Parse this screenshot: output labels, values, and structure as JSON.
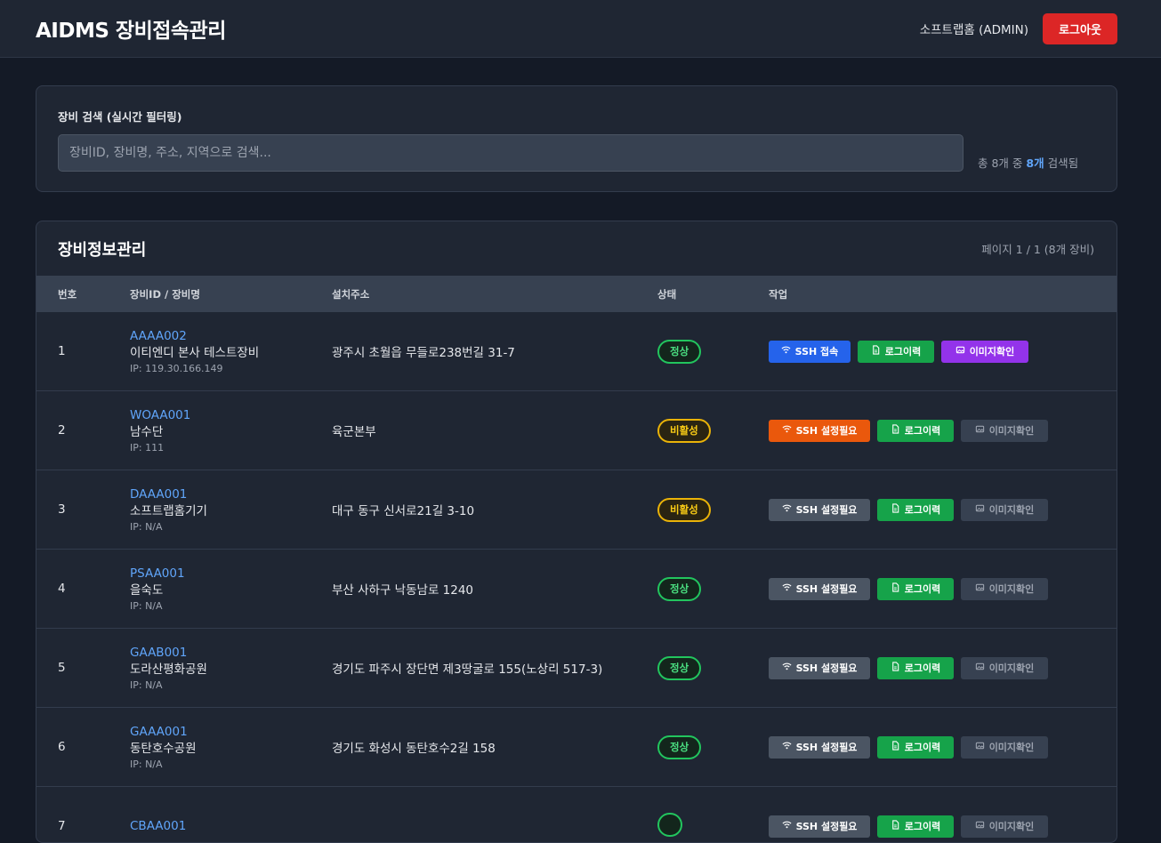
{
  "header": {
    "title": "AIDMS 장비접속관리",
    "user": "소프트랩홈 (ADMIN)",
    "logout_label": "로그아웃"
  },
  "search": {
    "label": "장비 검색 (실시간 필터링)",
    "placeholder": "장비ID, 장비명, 주소, 지역으로 검색...",
    "count_prefix": "총 8개 중",
    "count_value": "8개",
    "count_suffix": "검색됨"
  },
  "table": {
    "title": "장비정보관리",
    "page_info": "페이지 1 / 1 (8개 장비)",
    "columns": [
      "번호",
      "장비ID / 장비명",
      "설치주소",
      "상태",
      "작업"
    ],
    "rows": [
      {
        "no": "1",
        "id": "AAAA002",
        "name": "이티엔디 본사 테스트장비",
        "ip": "IP: 119.30.166.149",
        "address": "광주시 초월읍 무들로238번길 31-7",
        "status": "정상",
        "status_type": "ok",
        "ssh_label": "SSH 접속",
        "ssh_type": "blue",
        "log_label": "로그이력",
        "img_label": "이미지확인",
        "img_enabled": true
      },
      {
        "no": "2",
        "id": "WOAA001",
        "name": "남수단",
        "ip": "IP: 111",
        "address": "육군본부",
        "status": "비활성",
        "status_type": "inactive",
        "ssh_label": "SSH 설정필요",
        "ssh_type": "orange",
        "log_label": "로그이력",
        "img_label": "이미지확인",
        "img_enabled": false
      },
      {
        "no": "3",
        "id": "DAAA001",
        "name": "소프트랩홈기기",
        "ip": "IP: N/A",
        "address": "대구 동구 신서로21길 3-10",
        "status": "비활성",
        "status_type": "inactive",
        "ssh_label": "SSH 설정필요",
        "ssh_type": "gray",
        "log_label": "로그이력",
        "img_label": "이미지확인",
        "img_enabled": false
      },
      {
        "no": "4",
        "id": "PSAA001",
        "name": "을숙도",
        "ip": "IP: N/A",
        "address": "부산 사하구 낙동남로 1240",
        "status": "정상",
        "status_type": "ok",
        "ssh_label": "SSH 설정필요",
        "ssh_type": "gray",
        "log_label": "로그이력",
        "img_label": "이미지확인",
        "img_enabled": false
      },
      {
        "no": "5",
        "id": "GAAB001",
        "name": "도라산평화공원",
        "ip": "IP: N/A",
        "address": "경기도 파주시 장단면 제3땅굴로 155(노상리 517-3)",
        "status": "정상",
        "status_type": "ok",
        "ssh_label": "SSH 설정필요",
        "ssh_type": "gray",
        "log_label": "로그이력",
        "img_label": "이미지확인",
        "img_enabled": false
      },
      {
        "no": "6",
        "id": "GAAA001",
        "name": "동탄호수공원",
        "ip": "IP: N/A",
        "address": "경기도 화성시 동탄호수2길 158",
        "status": "정상",
        "status_type": "ok",
        "ssh_label": "SSH 설정필요",
        "ssh_type": "gray",
        "log_label": "로그이력",
        "img_label": "이미지확인",
        "img_enabled": false
      },
      {
        "no": "7",
        "id": "CBAA001",
        "name": "",
        "ip": "",
        "address": "",
        "status": "",
        "status_type": "ok",
        "ssh_label": "SSH 설정필요",
        "ssh_type": "gray",
        "log_label": "로그이력",
        "img_label": "이미지확인",
        "img_enabled": false
      }
    ]
  },
  "colors": {
    "background": "#141a26",
    "card": "#1f2633",
    "accent_blue": "#60a5fa",
    "danger": "#dc2626",
    "ok_green": "#22c55e",
    "inactive_yellow": "#eab308"
  },
  "icons": {
    "ssh": "wifi-icon",
    "log": "document-icon",
    "img": "image-icon"
  }
}
